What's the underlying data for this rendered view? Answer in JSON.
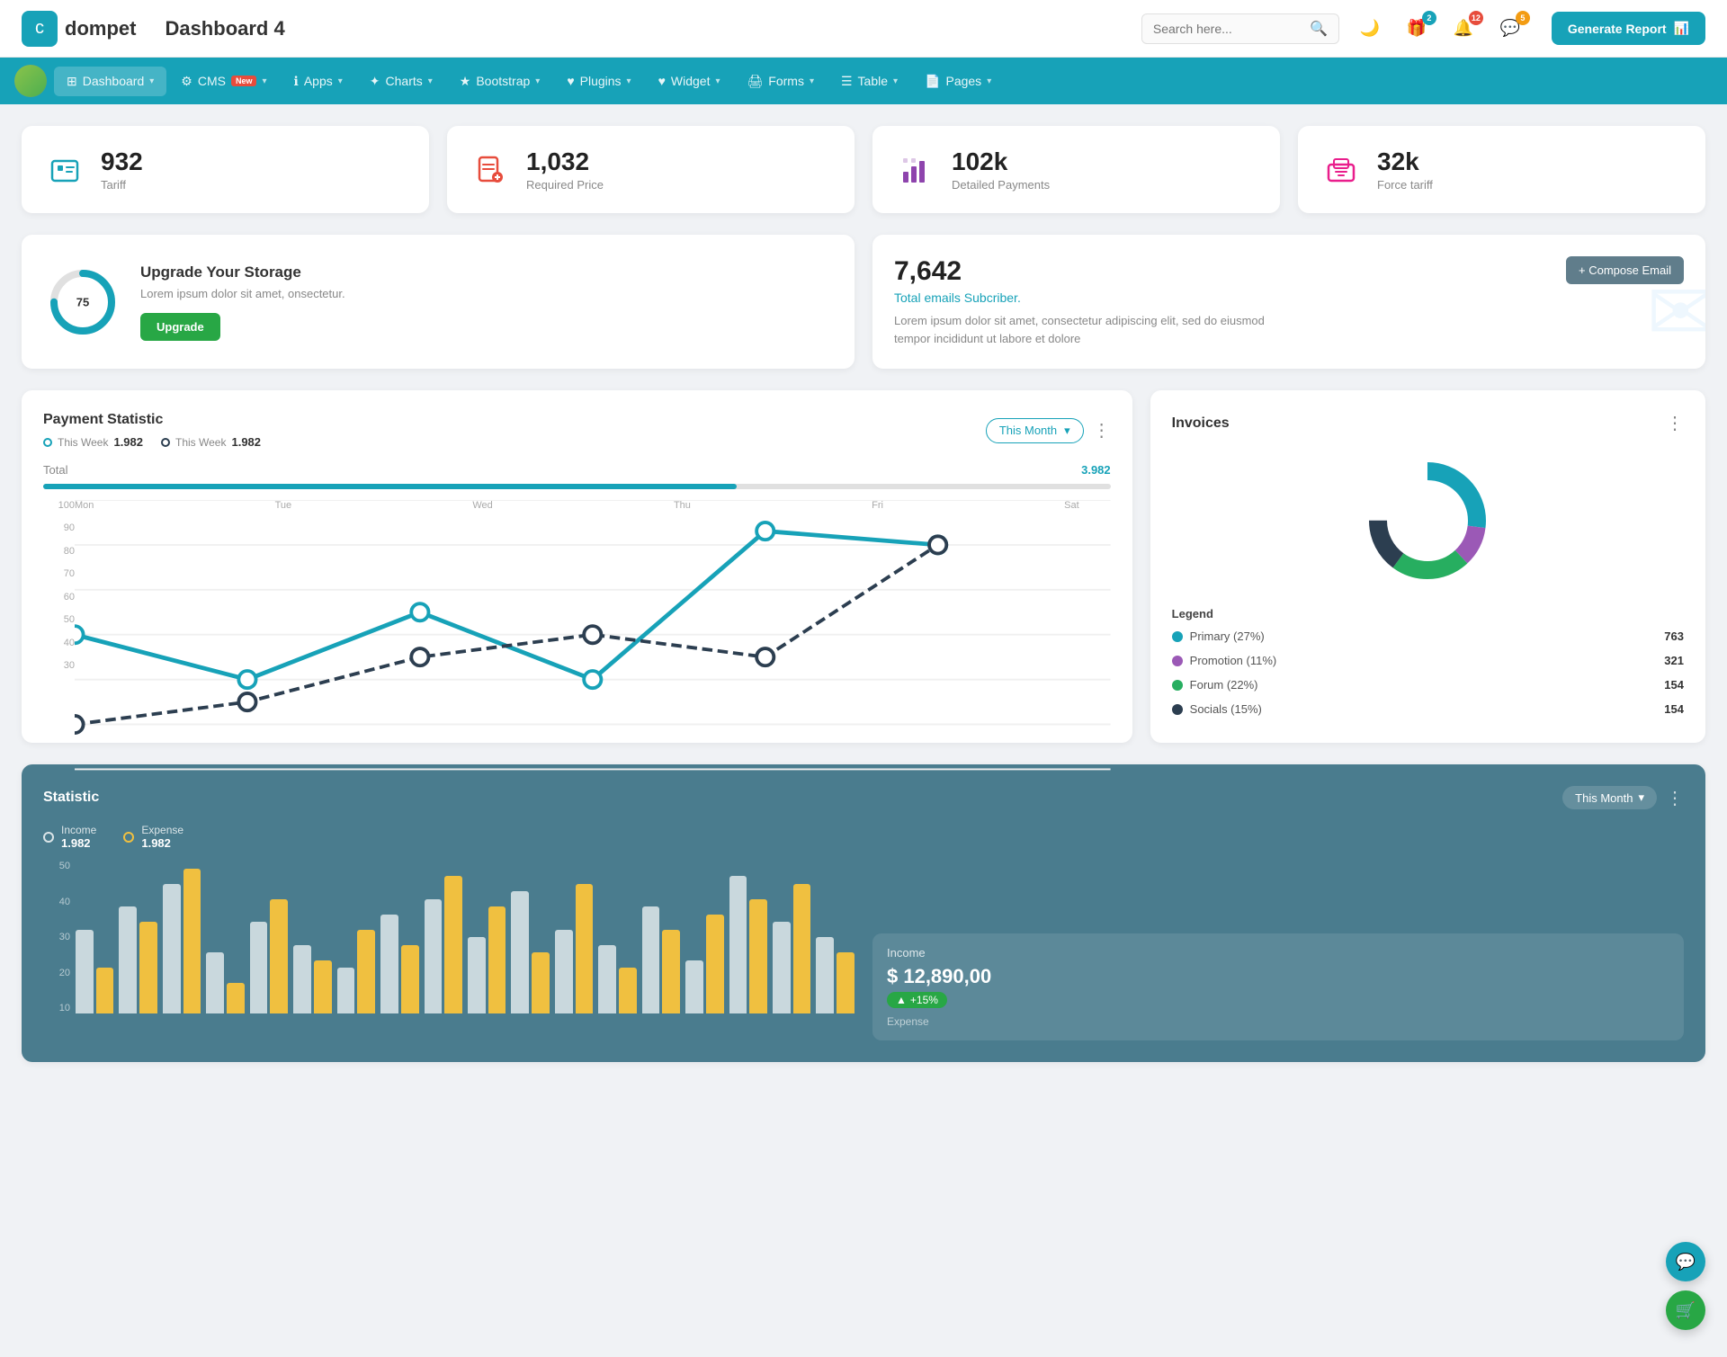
{
  "header": {
    "logo_icon": "💼",
    "logo_text": "dompet",
    "page_title": "Dashboard 4",
    "search_placeholder": "Search here...",
    "generate_btn": "Generate Report",
    "icons": {
      "moon": "🌙",
      "gift": "🎁",
      "bell": "🔔",
      "chat": "💬"
    },
    "badges": {
      "gift": "2",
      "bell": "12",
      "chat": "5"
    }
  },
  "navbar": {
    "items": [
      {
        "id": "dashboard",
        "label": "Dashboard",
        "active": true,
        "has_arrow": true,
        "icon": "⊞"
      },
      {
        "id": "cms",
        "label": "CMS",
        "active": false,
        "has_arrow": true,
        "has_new": true,
        "icon": "⚙"
      },
      {
        "id": "apps",
        "label": "Apps",
        "active": false,
        "has_arrow": true,
        "icon": "ℹ"
      },
      {
        "id": "charts",
        "label": "Charts",
        "active": false,
        "has_arrow": true,
        "icon": "✦"
      },
      {
        "id": "bootstrap",
        "label": "Bootstrap",
        "active": false,
        "has_arrow": true,
        "icon": "★"
      },
      {
        "id": "plugins",
        "label": "Plugins",
        "active": false,
        "has_arrow": true,
        "icon": "♥"
      },
      {
        "id": "widget",
        "label": "Widget",
        "active": false,
        "has_arrow": true,
        "icon": "♥"
      },
      {
        "id": "forms",
        "label": "Forms",
        "active": false,
        "has_arrow": true,
        "icon": "🖨"
      },
      {
        "id": "table",
        "label": "Table",
        "active": false,
        "has_arrow": true,
        "icon": "☰"
      },
      {
        "id": "pages",
        "label": "Pages",
        "active": false,
        "has_arrow": true,
        "icon": "📄"
      }
    ]
  },
  "stats": [
    {
      "id": "tariff",
      "value": "932",
      "label": "Tariff",
      "icon": "briefcase",
      "color": "teal"
    },
    {
      "id": "required-price",
      "value": "1,032",
      "label": "Required Price",
      "icon": "file-add",
      "color": "red"
    },
    {
      "id": "detailed-payments",
      "value": "102k",
      "label": "Detailed Payments",
      "icon": "chart",
      "color": "purple"
    },
    {
      "id": "force-tariff",
      "value": "32k",
      "label": "Force tariff",
      "icon": "building",
      "color": "pink"
    }
  ],
  "storage": {
    "percent": 75,
    "title": "Upgrade Your Storage",
    "desc": "Lorem ipsum dolor sit amet, onsectetur.",
    "btn_label": "Upgrade"
  },
  "email": {
    "count": "7,642",
    "subtitle": "Total emails Subcriber.",
    "desc": "Lorem ipsum dolor sit amet, consectetur adipiscing elit, sed do eiusmod tempor incididunt ut labore et dolore",
    "compose_btn": "+ Compose Email"
  },
  "payment_chart": {
    "title": "Payment Statistic",
    "legend1_label": "This Week",
    "legend1_value": "1.982",
    "legend2_label": "This Week",
    "legend2_value": "1.982",
    "month_btn": "This Month",
    "total_label": "Total",
    "total_value": "3.982",
    "progress": 65,
    "y_labels": [
      "100",
      "90",
      "80",
      "70",
      "60",
      "50",
      "40",
      "30"
    ],
    "x_labels": [
      "Mon",
      "Tue",
      "Wed",
      "Thu",
      "Fri",
      "Sat"
    ]
  },
  "invoices": {
    "title": "Invoices",
    "legend_title": "Legend",
    "items": [
      {
        "label": "Primary (27%)",
        "color": "#17a2b8",
        "value": "763"
      },
      {
        "label": "Promotion (11%)",
        "color": "#9b59b6",
        "value": "321"
      },
      {
        "label": "Forum (22%)",
        "color": "#27ae60",
        "value": "154"
      },
      {
        "label": "Socials (15%)",
        "color": "#2c3e50",
        "value": "154"
      }
    ],
    "donut": {
      "segments": [
        27,
        11,
        22,
        15
      ],
      "colors": [
        "#17a2b8",
        "#9b59b6",
        "#27ae60",
        "#2c3e50"
      ]
    }
  },
  "statistic": {
    "title": "Statistic",
    "month_btn": "This Month",
    "legend_income_label": "Income",
    "legend_income_value": "1.982",
    "legend_expense_label": "Expense",
    "legend_expense_value": "1.982",
    "income_title": "Income",
    "income_value": "$ 12,890,00",
    "income_badge": "+15%",
    "y_labels": [
      "50",
      "40",
      "30",
      "20",
      "10"
    ],
    "bars": [
      {
        "white": 55,
        "yellow": 30
      },
      {
        "white": 70,
        "yellow": 60
      },
      {
        "white": 85,
        "yellow": 95
      },
      {
        "white": 40,
        "yellow": 20
      },
      {
        "white": 60,
        "yellow": 75
      },
      {
        "white": 45,
        "yellow": 35
      },
      {
        "white": 30,
        "yellow": 55
      },
      {
        "white": 65,
        "yellow": 45
      },
      {
        "white": 75,
        "yellow": 90
      },
      {
        "white": 50,
        "yellow": 70
      },
      {
        "white": 80,
        "yellow": 40
      },
      {
        "white": 55,
        "yellow": 85
      },
      {
        "white": 45,
        "yellow": 30
      },
      {
        "white": 70,
        "yellow": 55
      },
      {
        "white": 35,
        "yellow": 65
      },
      {
        "white": 90,
        "yellow": 75
      },
      {
        "white": 60,
        "yellow": 85
      },
      {
        "white": 50,
        "yellow": 40
      }
    ]
  }
}
